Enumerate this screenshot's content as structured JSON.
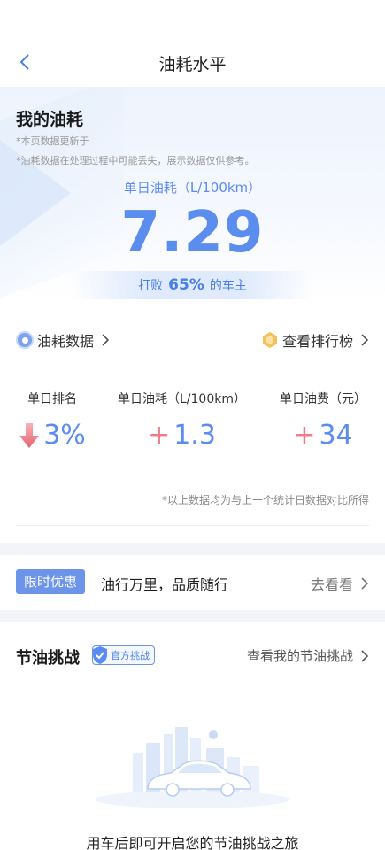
{
  "header": {
    "title": "油耗水平"
  },
  "hero": {
    "title": "我的油耗",
    "note1": "*本页数据更新于",
    "note2": "*油耗数据在处理过程中可能丢失，展示数据仅供参考。",
    "metric_label": "单日油耗（L/100km）",
    "metric_value": "7.29",
    "beat_prefix": "打败",
    "beat_pct": "65%",
    "beat_suffix": "的车主"
  },
  "links": {
    "fuel_data": "油耗数据",
    "ranking": "查看排行榜"
  },
  "stats": [
    {
      "label": "单日排名",
      "value": "3%",
      "trend": "down"
    },
    {
      "label": "单日油耗（L/100km）",
      "value": "1.3",
      "trend": "up"
    },
    {
      "label": "单日油费（元）",
      "value": "34",
      "trend": "up"
    }
  ],
  "stats_note": "*以上数据均为与上一个统计日数据对比所得",
  "promo": {
    "tag": "限时优惠",
    "text": "油行万里，品质随行",
    "link": "去看看"
  },
  "challenge": {
    "title": "节油挑战",
    "badge": "官方挑战",
    "link": "查看我的节油挑战",
    "empty_text": "用车后即可开启您的节油挑战之旅"
  },
  "colors": {
    "accent": "#5b8def",
    "increase": "#ef7c8a",
    "decrease": "#e8616f"
  }
}
